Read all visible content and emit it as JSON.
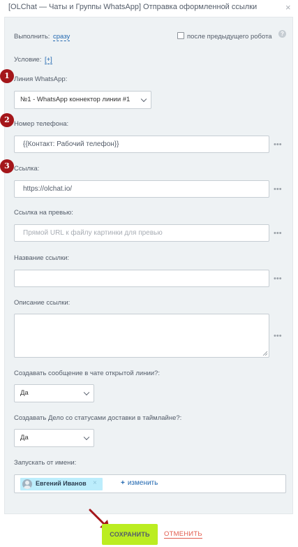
{
  "dialog": {
    "title": "[OLChat — Чаты и Группы WhatsApp] Отправка оформленной ссылки",
    "close_glyph": "×"
  },
  "execute": {
    "label": "Выполнить:",
    "value": "сразу",
    "after_previous_robot_label": "после предыдущего робота",
    "help_glyph": "?"
  },
  "condition": {
    "label": "Условие:",
    "add_label": "[+]"
  },
  "markers": [
    "1",
    "2",
    "3"
  ],
  "whatsapp_line": {
    "label": "Линия WhatsApp:",
    "selected": "№1 - WhatsApp коннектор линии #1"
  },
  "phone": {
    "label": "Номер телефона:",
    "value": "{{Контакт: Рабочий телефон}}"
  },
  "link": {
    "label": "Ссылка:",
    "value": "https://olchat.io/"
  },
  "preview_link": {
    "label": "Ссылка на превью:",
    "placeholder": "Прямой URL к файлу картинки для превью"
  },
  "link_name": {
    "label": "Название ссылки:",
    "value": ""
  },
  "link_description": {
    "label": "Описание ссылки:",
    "value": ""
  },
  "create_message": {
    "label": "Создавать сообщение в чате открытой линии?:",
    "selected": "Да"
  },
  "create_task": {
    "label": "Создавать Дело со статусами доставки в таймлайне?:",
    "selected": "Да"
  },
  "run_as": {
    "label": "Запускать от имени:",
    "user_name": "Евгений Иванов",
    "remove_glyph": "×",
    "change_plus": "+",
    "change_label": "изменить"
  },
  "more_glyph": "•••",
  "footer": {
    "save_label": "СОХРАНИТЬ",
    "cancel_label": "ОТМЕНИТЬ"
  },
  "colors": {
    "save_button": "#bbed21",
    "marker": "#a4161a",
    "link": "#2067b0",
    "cancel": "#e25b4d",
    "panel": "#eef2f4",
    "user_tag": "#bcedfc"
  }
}
